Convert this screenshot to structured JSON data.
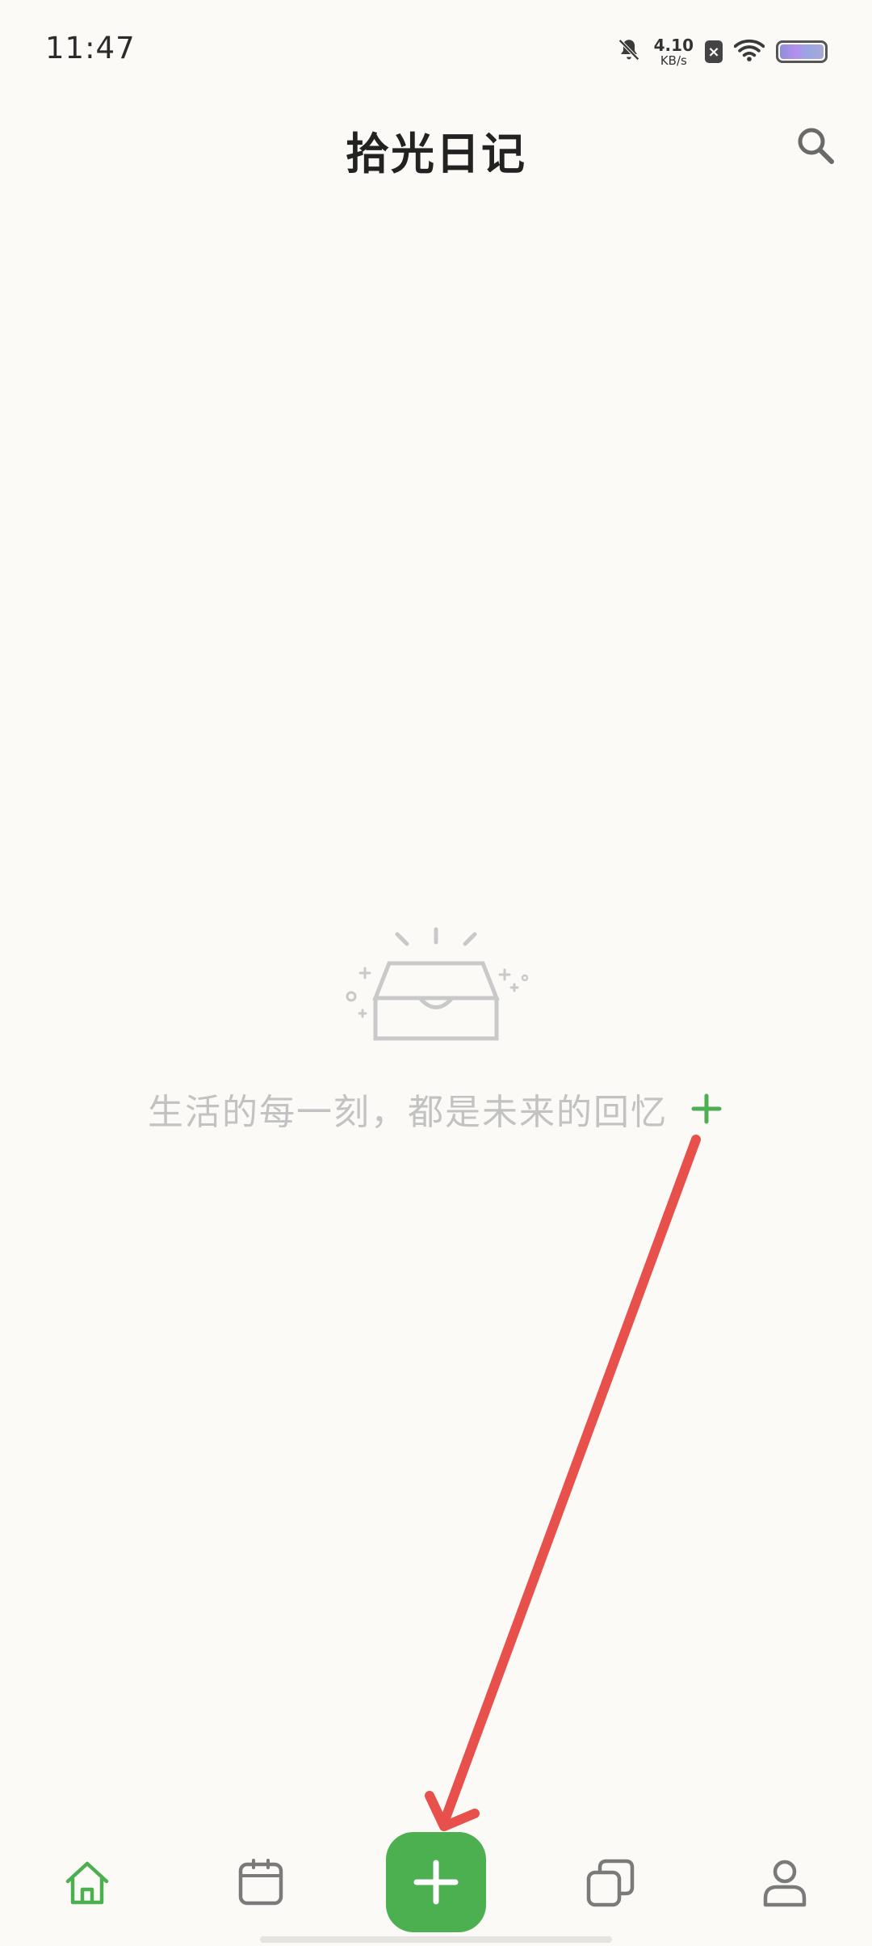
{
  "status_bar": {
    "time": "11:47",
    "net_speed_value": "4.10",
    "net_speed_unit": "KB/s",
    "icons": [
      "bell-muted-icon",
      "sim-x-icon",
      "wifi-icon",
      "battery-icon"
    ]
  },
  "header": {
    "title": "拾光日记",
    "search_icon": "search-icon"
  },
  "empty_state": {
    "illustration": "empty-inbox-icon",
    "message": "生活的每一刻，都是未来的回忆",
    "add_icon": "plus-icon"
  },
  "bottom_nav": {
    "items": [
      {
        "icon": "home-icon",
        "active": true
      },
      {
        "icon": "calendar-icon",
        "active": false
      },
      {
        "icon": "plus-icon",
        "active": false
      },
      {
        "icon": "cards-icon",
        "active": false
      },
      {
        "icon": "profile-icon",
        "active": false
      }
    ]
  },
  "colors": {
    "background": "#fcfaf6",
    "accent": "#4caf50",
    "annotation_arrow": "#e8504c",
    "empty_text": "#c2c2c2"
  }
}
